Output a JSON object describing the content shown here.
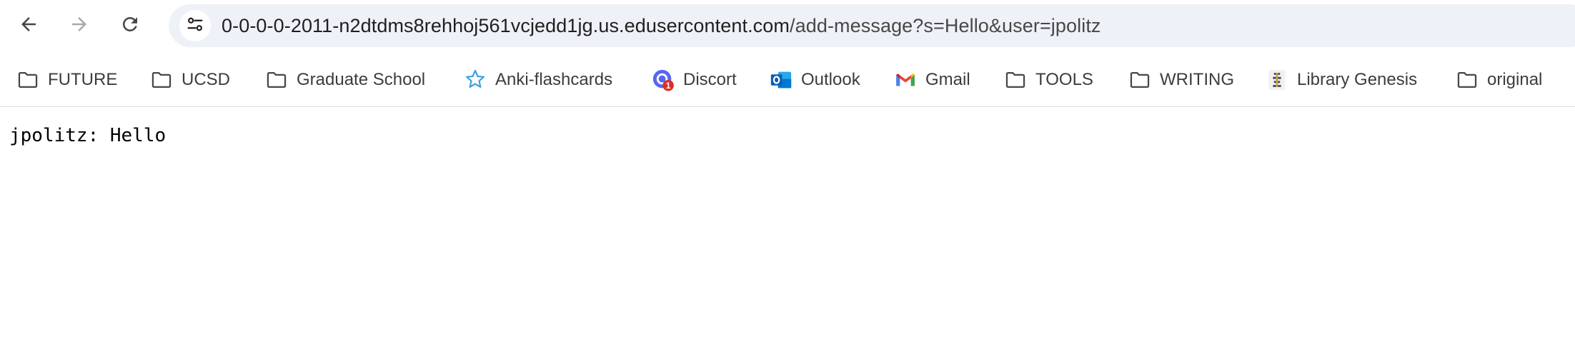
{
  "browser": {
    "url_host": "0-0-0-0-2011-n2dtdms8rehhoj561vcjedd1jg.us.edusercontent.com",
    "url_path": "/add-message?s=Hello&user=jpolitz"
  },
  "bookmarks": [
    {
      "label": "FUTURE",
      "icon": "folder-icon"
    },
    {
      "label": "UCSD",
      "icon": "folder-icon"
    },
    {
      "label": "Graduate School",
      "icon": "folder-icon"
    },
    {
      "label": "Anki-flashcards",
      "icon": "anki-star-icon"
    },
    {
      "label": "Discort",
      "icon": "discord-icon"
    },
    {
      "label": "Outlook",
      "icon": "outlook-icon"
    },
    {
      "label": "Gmail",
      "icon": "gmail-icon"
    },
    {
      "label": "TOOLS",
      "icon": "folder-icon"
    },
    {
      "label": "WRITING",
      "icon": "folder-icon"
    },
    {
      "label": "Library Genesis",
      "icon": "library-genesis-icon"
    },
    {
      "label": "original",
      "icon": "folder-icon"
    }
  ],
  "page": {
    "message": "jpolitz: Hello"
  },
  "colors": {
    "omnibox_bg": "#eef1f7",
    "text": "#1f1f1f",
    "discord_badge": "#d93025"
  }
}
